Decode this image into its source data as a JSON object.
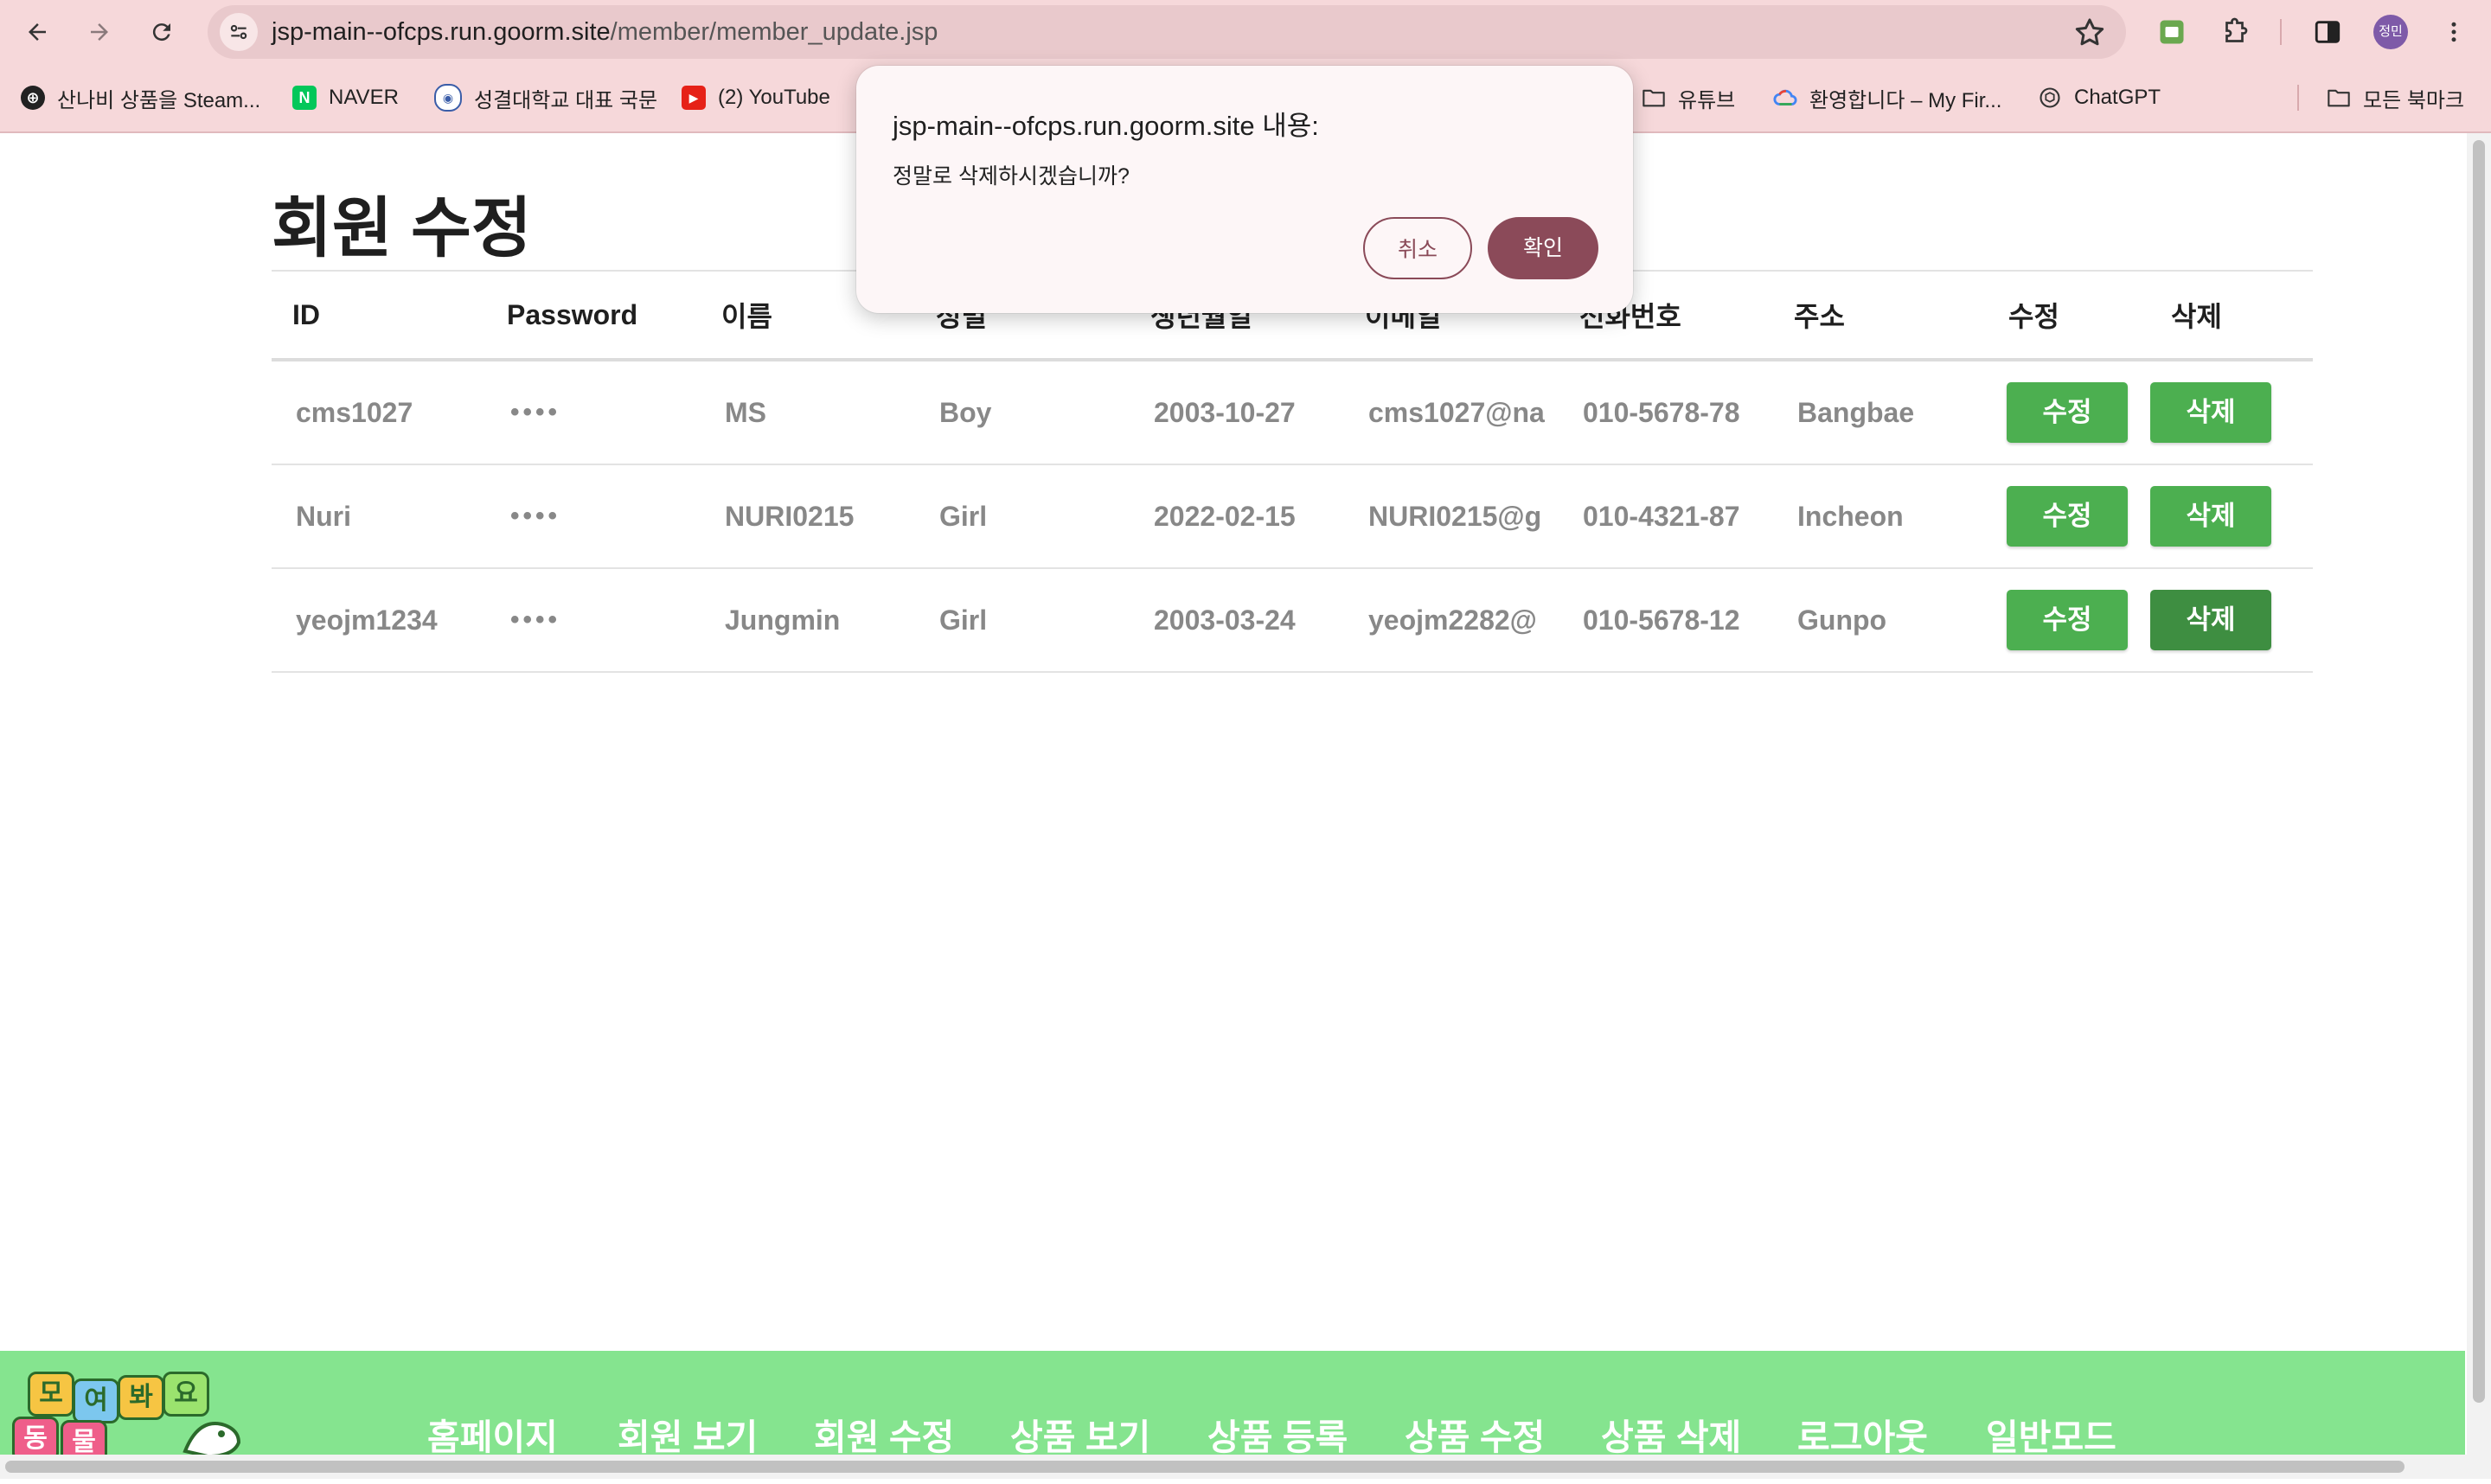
{
  "browser": {
    "url_host": "jsp-main--ofcps.run.goorm.site",
    "url_path": "/member/member_update.jsp",
    "profile_initials": "정민",
    "accent_color": "#f6d8da"
  },
  "bookmarks": {
    "items": [
      {
        "label": "산나비 상품을 Steam...",
        "icon": "steam-globe-icon"
      },
      {
        "label": "NAVER",
        "icon": "naver-icon"
      },
      {
        "label": "성결대학교 대표 국문",
        "icon": "university-icon"
      },
      {
        "label": "(2) YouTube",
        "icon": "youtube-icon"
      },
      {
        "label": "유튜브",
        "icon": "folder-icon"
      },
      {
        "label": "환영합니다 – My Fir...",
        "icon": "google-cloud-icon"
      },
      {
        "label": "ChatGPT",
        "icon": "chatgpt-icon"
      }
    ],
    "all_bookmarks_label": "모든 북마크"
  },
  "page": {
    "title": "회원 수정",
    "table": {
      "headers": [
        "ID",
        "Password",
        "이름",
        "성별",
        "생년월일",
        "이메일",
        "전화번호",
        "주소",
        "수정",
        "삭제"
      ],
      "rows": [
        {
          "id": "cms1027",
          "password": "••••",
          "name": "MS",
          "gender": "Boy",
          "birth": "2003-10-27",
          "email": "cms1027@na",
          "phone": "010-5678-78",
          "address": "Bangbae",
          "edit": "수정",
          "delete": "삭제"
        },
        {
          "id": "Nuri",
          "password": "••••",
          "name": "NURI0215",
          "gender": "Girl",
          "birth": "2022-02-15",
          "email": "NURI0215@g",
          "phone": "010-4321-87",
          "address": "Incheon",
          "edit": "수정",
          "delete": "삭제"
        },
        {
          "id": "yeojm1234",
          "password": "••••",
          "name": "Jungmin",
          "gender": "Girl",
          "birth": "2003-03-24",
          "email": "yeojm2282@",
          "phone": "010-5678-12",
          "address": "Gunpo",
          "edit": "수정",
          "delete": "삭제"
        }
      ],
      "button_color": "#4caf50"
    }
  },
  "footer": {
    "logo_text": [
      "모",
      "여",
      "봐",
      "요",
      "동",
      "물"
    ],
    "nav": [
      "홈페이지",
      "회원 보기",
      "회원 수정",
      "상품 보기",
      "상품 등록",
      "상품 수정",
      "상품 삭제",
      "로그아웃",
      "일반모드"
    ],
    "background": "#85e48f"
  },
  "dialog": {
    "title": "jsp-main--ofcps.run.goorm.site 내용:",
    "message": "정말로 삭제하시겠습니까?",
    "cancel_label": "취소",
    "ok_label": "확인",
    "ok_color": "#8b4a59"
  }
}
